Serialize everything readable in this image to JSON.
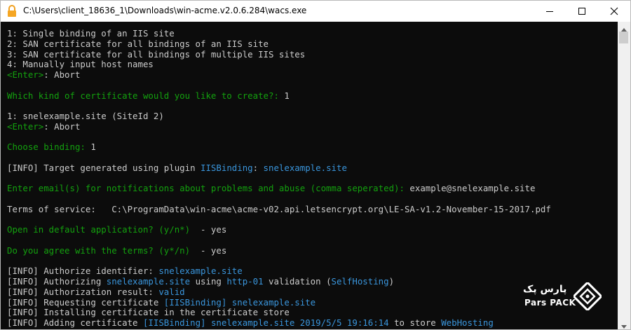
{
  "window": {
    "title": "C:\\Users\\client_18636_1\\Downloads\\win-acme.v2.0.6.284\\wacs.exe"
  },
  "console": {
    "lines": [
      [
        {
          "t": "1: Single binding of an IIS site",
          "c": "w"
        }
      ],
      [
        {
          "t": "2: SAN certificate for all bindings of an IIS site",
          "c": "w"
        }
      ],
      [
        {
          "t": "3: SAN certificate for all bindings of multiple IIS sites",
          "c": "w"
        }
      ],
      [
        {
          "t": "4: Manually input host names",
          "c": "w"
        }
      ],
      [
        {
          "t": "<Enter>",
          "c": "g"
        },
        {
          "t": ": Abort",
          "c": "w"
        }
      ],
      [],
      [
        {
          "t": "Which kind of certificate would you like to create?: ",
          "c": "g"
        },
        {
          "t": "1",
          "c": "w"
        }
      ],
      [],
      [
        {
          "t": "1: snelexample.site (SiteId 2)",
          "c": "w"
        }
      ],
      [
        {
          "t": "<Enter>",
          "c": "g"
        },
        {
          "t": ": Abort",
          "c": "w"
        }
      ],
      [],
      [
        {
          "t": "Choose binding: ",
          "c": "g"
        },
        {
          "t": "1",
          "c": "w"
        }
      ],
      [],
      [
        {
          "t": "[INFO] Target generated using plugin ",
          "c": "w"
        },
        {
          "t": "IISBinding",
          "c": "c"
        },
        {
          "t": ": ",
          "c": "w"
        },
        {
          "t": "snelexample.site",
          "c": "c"
        }
      ],
      [],
      [
        {
          "t": "Enter email(s) for notifications about problems and abuse (comma seperated): ",
          "c": "g"
        },
        {
          "t": "example@snelexample.site",
          "c": "w"
        }
      ],
      [],
      [
        {
          "t": "Terms of service:   C:\\ProgramData\\win-acme\\acme-v02.api.letsencrypt.org\\LE-SA-v1.2-November-15-2017.pdf",
          "c": "w"
        }
      ],
      [],
      [
        {
          "t": "Open in default application? (y/n*)",
          "c": "g"
        },
        {
          "t": "  - yes",
          "c": "w"
        }
      ],
      [],
      [
        {
          "t": "Do you agree with the terms? (y*/n)",
          "c": "g"
        },
        {
          "t": "  - yes",
          "c": "w"
        }
      ],
      [],
      [
        {
          "t": "[INFO] Authorize identifier: ",
          "c": "w"
        },
        {
          "t": "snelexample.site",
          "c": "c"
        }
      ],
      [
        {
          "t": "[INFO] Authorizing ",
          "c": "w"
        },
        {
          "t": "snelexample.site",
          "c": "c"
        },
        {
          "t": " using ",
          "c": "w"
        },
        {
          "t": "http-01",
          "c": "c"
        },
        {
          "t": " validation (",
          "c": "w"
        },
        {
          "t": "SelfHosting",
          "c": "c"
        },
        {
          "t": ")",
          "c": "w"
        }
      ],
      [
        {
          "t": "[INFO] Authorization result: ",
          "c": "w"
        },
        {
          "t": "valid",
          "c": "c"
        }
      ],
      [
        {
          "t": "[INFO] Requesting certificate ",
          "c": "w"
        },
        {
          "t": "[IISBinding] snelexample.site",
          "c": "c"
        }
      ],
      [
        {
          "t": "[INFO] Installing certificate in the certificate store",
          "c": "w"
        }
      ],
      [
        {
          "t": "[INFO] Adding certificate ",
          "c": "w"
        },
        {
          "t": "[IISBinding] snelexample.site",
          "c": "c"
        },
        {
          "t": " ",
          "c": "w"
        },
        {
          "t": "2019/5/5 19:16:14",
          "c": "c"
        },
        {
          "t": " to store ",
          "c": "w"
        },
        {
          "t": "WebHosting",
          "c": "c"
        }
      ]
    ]
  },
  "watermark": {
    "persian_text": "پارس پک",
    "english_text": "Pars PACK"
  },
  "colors": {
    "background": "#0c0c0c",
    "text": "#cccccc",
    "prompt_green": "#13a10e",
    "highlight_cyan": "#3a96dd"
  },
  "icons": {
    "app": "lock-icon",
    "minimize": "minimize-icon",
    "maximize": "maximize-icon",
    "close": "close-icon"
  }
}
